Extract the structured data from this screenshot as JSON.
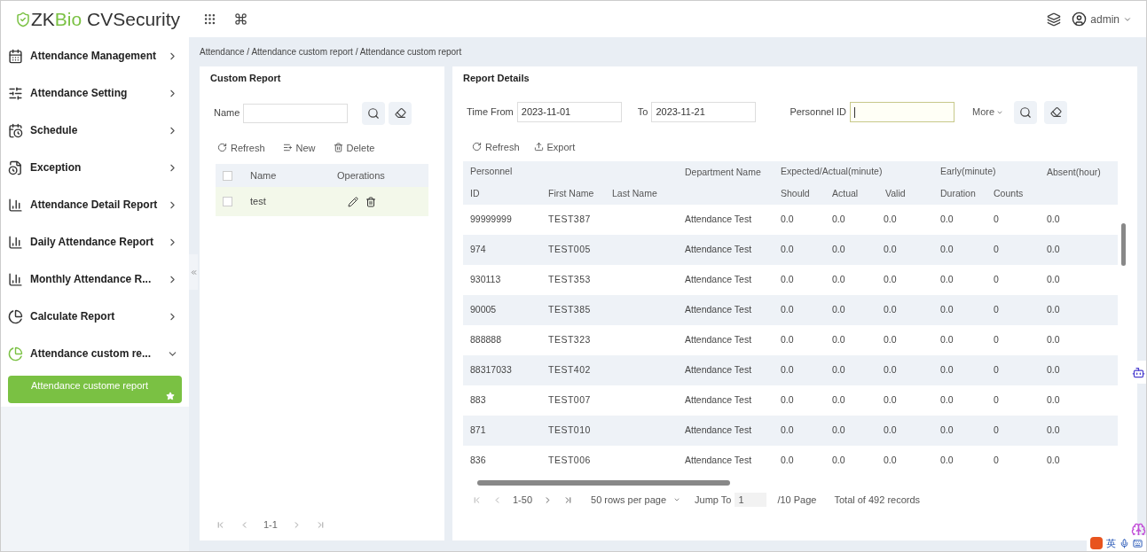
{
  "header": {
    "logo": {
      "part_1": "ZK",
      "part_2": "Bio",
      "part_3": " CVSecurity"
    },
    "user": "admin"
  },
  "sidebar": {
    "items": [
      {
        "label": "Attendance Management",
        "kind": "calendar",
        "expanded": false
      },
      {
        "label": "Attendance Setting",
        "kind": "setting",
        "expanded": false
      },
      {
        "label": "Schedule",
        "kind": "schedule",
        "expanded": false
      },
      {
        "label": "Exception",
        "kind": "exception",
        "expanded": false
      },
      {
        "label": "Attendance Detail Report",
        "kind": "chart",
        "expanded": false
      },
      {
        "label": "Daily Attendance Report",
        "kind": "chart",
        "expanded": false
      },
      {
        "label": "Monthly Attendance R...",
        "kind": "chart",
        "expanded": false
      },
      {
        "label": "Calculate Report",
        "kind": "pie",
        "expanded": false
      },
      {
        "label": "Attendance custom re...",
        "kind": "pie",
        "expanded": true,
        "children": [
          {
            "label": "Attendance custome report",
            "selected": true
          }
        ]
      }
    ]
  },
  "breadcrumb": "Attendance / Attendance custom report / Attendance custom report",
  "custom_report": {
    "title": "Custom Report",
    "filter_label": "Name",
    "toolbar": [
      "Refresh",
      "New",
      "Delete"
    ],
    "columns": [
      "Name",
      "Operations"
    ],
    "select_all_checked": false,
    "rows": [
      {
        "name": "test",
        "checked": false
      }
    ],
    "pagination": "1-1"
  },
  "report_details": {
    "title": "Report Details",
    "filters": [
      {
        "label": "Time From",
        "value": "2023-11-01",
        "focused": false
      },
      {
        "label": "To",
        "value": "2023-11-21",
        "focused": false
      },
      {
        "label": "Personnel ID",
        "focused": true
      }
    ],
    "more": "More",
    "toolbar": [
      "Refresh",
      "Export"
    ],
    "header_groups": [
      "Personnel",
      "Department Name",
      "Expected/Actual(minute)",
      "Early(minute)",
      "Absent(hour)"
    ],
    "columns": [
      "ID",
      "First Name",
      "Last Name",
      "",
      "Should",
      "Actual",
      "Valid",
      "Duration",
      "Counts"
    ],
    "rows": [
      [
        "99999999",
        "TEST387",
        "",
        "Attendance Test",
        "0.0",
        "0.0",
        "0.0",
        "0.0",
        "0",
        "0.0"
      ],
      [
        "974",
        "TEST005",
        "",
        "Attendance Test",
        "0.0",
        "0.0",
        "0.0",
        "0.0",
        "0",
        "0.0"
      ],
      [
        "930113",
        "TEST353",
        "",
        "Attendance Test",
        "0.0",
        "0.0",
        "0.0",
        "0.0",
        "0",
        "0.0"
      ],
      [
        "90005",
        "TEST385",
        "",
        "Attendance Test",
        "0.0",
        "0.0",
        "0.0",
        "0.0",
        "0",
        "0.0"
      ],
      [
        "888888",
        "TEST323",
        "",
        "Attendance Test",
        "0.0",
        "0.0",
        "0.0",
        "0.0",
        "0",
        "0.0"
      ],
      [
        "88317033",
        "TEST402",
        "",
        "Attendance Test",
        "0.0",
        "0.0",
        "0.0",
        "0.0",
        "0",
        "0.0"
      ],
      [
        "883",
        "TEST007",
        "",
        "Attendance Test",
        "0.0",
        "0.0",
        "0.0",
        "0.0",
        "0",
        "0.0"
      ],
      [
        "871",
        "TEST010",
        "",
        "Attendance Test",
        "0.0",
        "0.0",
        "0.0",
        "0.0",
        "0",
        "0.0"
      ],
      [
        "836",
        "TEST006",
        "",
        "Attendance Test",
        "0.0",
        "0.0",
        "0.0",
        "0.0",
        "0",
        "0.0"
      ]
    ],
    "pagination": {
      "range": "1-50",
      "per_page": "50 rows per page",
      "jump_label": "Jump To",
      "jump_value": "1",
      "pages": "/10 Page",
      "total": "Total of 492 records"
    }
  },
  "ime_toolbar": {
    "language": "英"
  }
}
